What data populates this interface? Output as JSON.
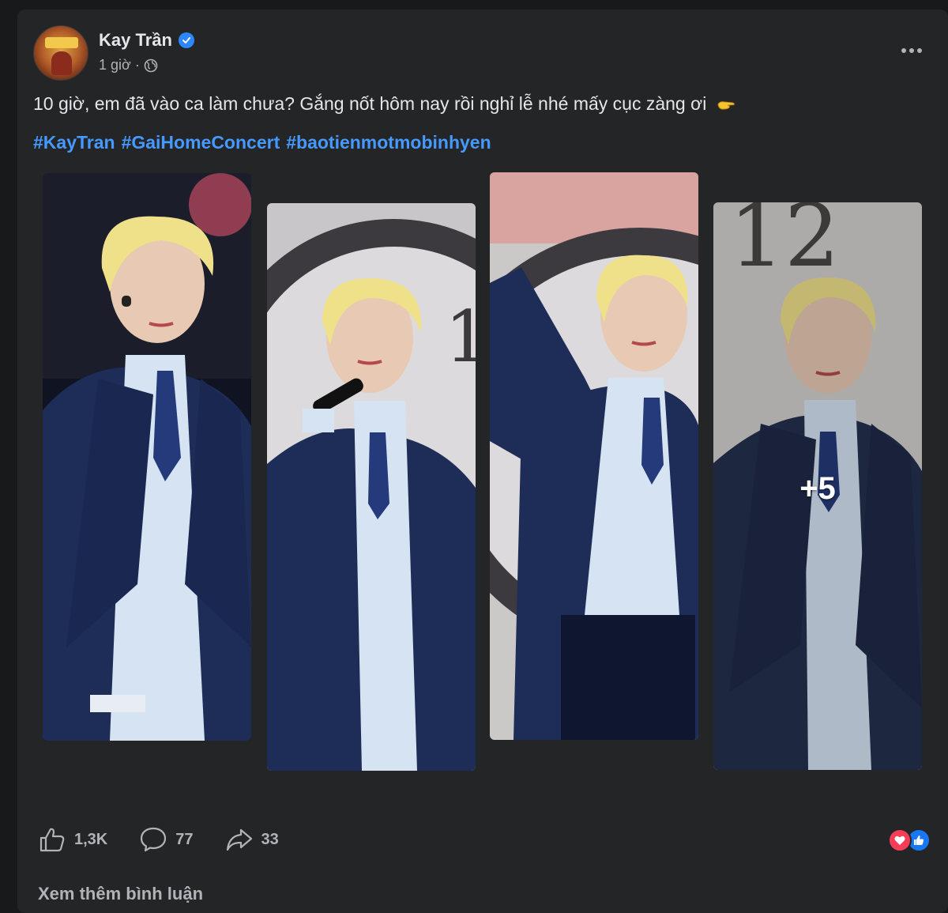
{
  "post": {
    "author": "Kay Trần",
    "time": "1 giờ",
    "separator": "·",
    "caption": "10 giờ, em đã vào ca làm chưa? Gắng nốt hôm nay rồi nghỉ lễ nhé mấy cục zàng ơi",
    "hashtags": [
      "#KayTran",
      "#GaiHomeConcert",
      "#baotienmotmobinhyen"
    ],
    "more_photos_label": "+5"
  },
  "stats": {
    "likes": "1,3K",
    "comments": "77",
    "shares": "33"
  },
  "footer": {
    "see_more_comments": "Xem thêm bình luận"
  },
  "icons": {
    "verified": "verified-badge-icon",
    "audience": "globe-icon",
    "more": "more-options-icon",
    "like": "thumbs-up-icon",
    "comment": "comment-bubble-icon",
    "share": "share-arrow-icon",
    "reaction_love": "heart-icon",
    "reaction_like": "like-icon"
  },
  "colors": {
    "background": "#18191a",
    "card": "#242526",
    "text": "#e4e6eb",
    "muted": "#b0b3b8",
    "hashtag": "#4599ff",
    "verified": "#2d88ff",
    "love": "#f33e58",
    "like": "#1877f2"
  }
}
